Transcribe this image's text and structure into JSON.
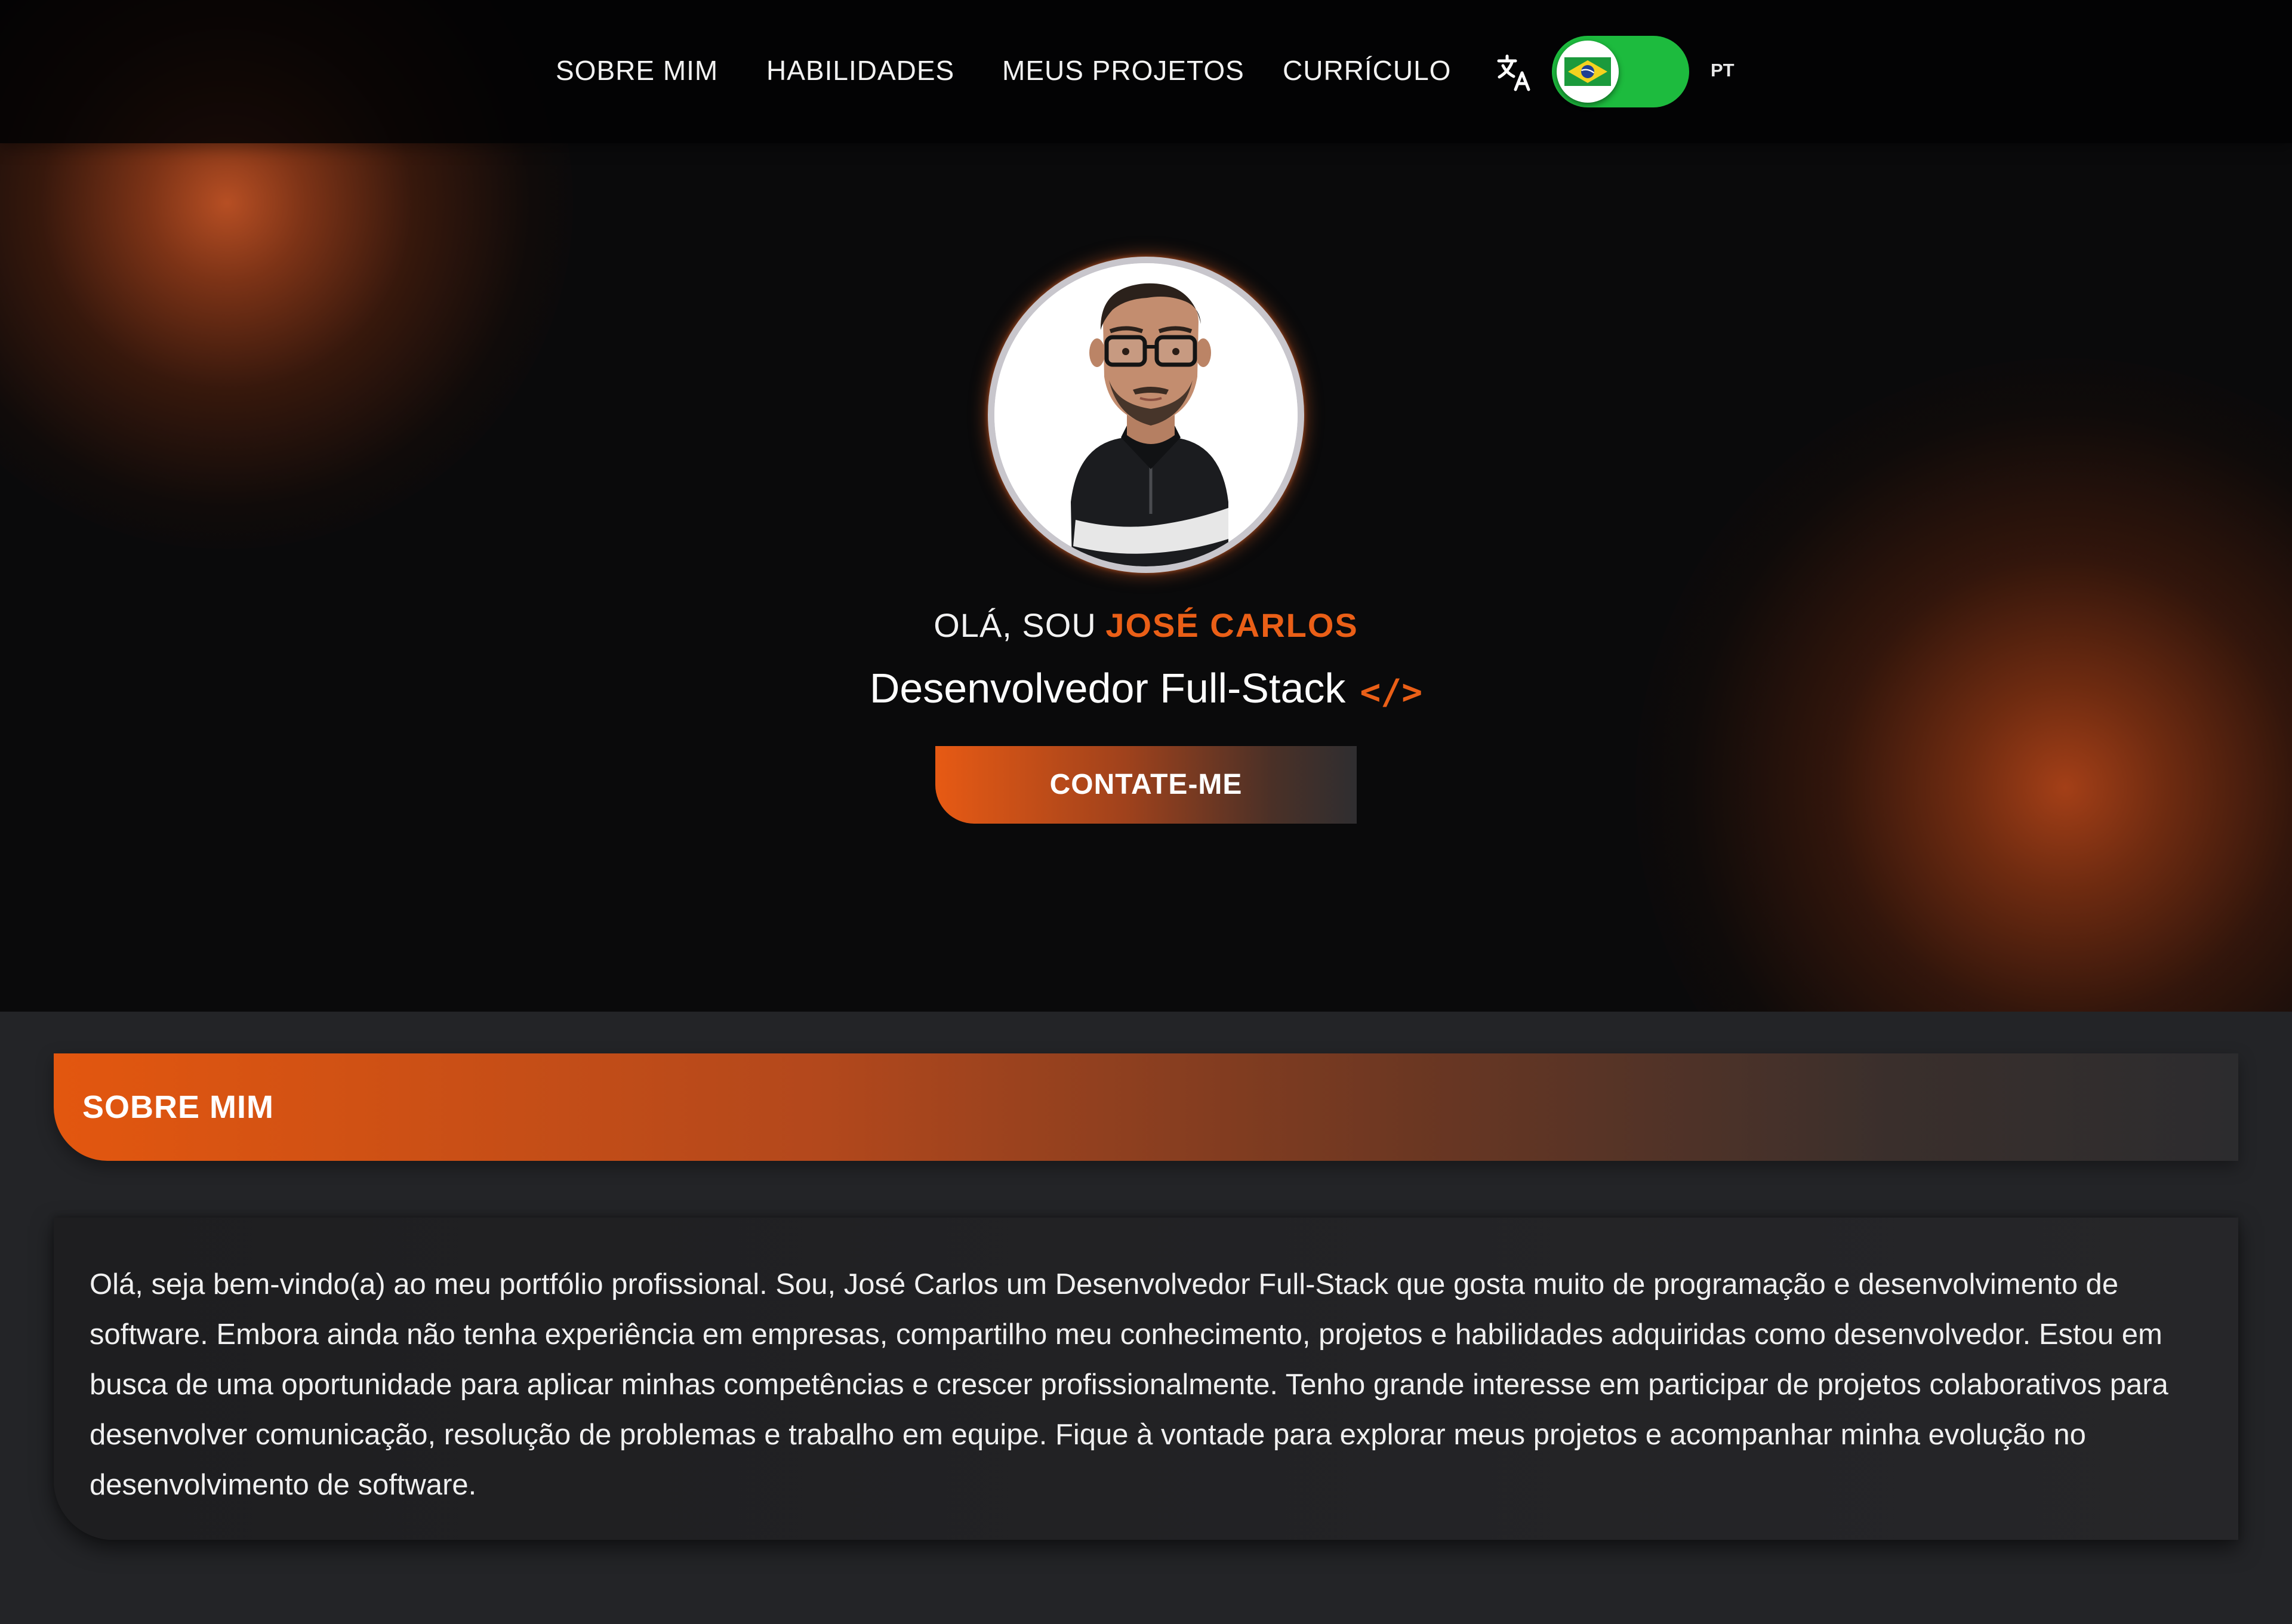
{
  "nav": {
    "links": [
      "SOBRE MIM",
      "HABILIDADES",
      "MEUS PROJETOS",
      "CURRÍCULO"
    ],
    "language_code": "PT",
    "translate_icon": "translate-icon",
    "flag_icon": "brazil-flag-icon"
  },
  "hero": {
    "greeting_prefix": "OLÁ, SOU",
    "name": "JOSÉ CARLOS",
    "role": "Desenvolvedor Full-Stack",
    "role_icon": "</>",
    "contact_button": "CONTATE-ME"
  },
  "about": {
    "title": "SOBRE MIM",
    "text": "Olá, seja bem-vindo(a) ao meu portfólio profissional. Sou, José Carlos um Desenvolvedor Full-Stack que gosta muito de programação e desenvolvimento de software. Embora ainda não tenha experiência em empresas, compartilho meu conhecimento, projetos e habilidades adquiridas como desenvolvedor. Estou em busca de uma oportunidade para aplicar minhas competências e crescer profissionalmente. Tenho grande interesse em participar de projetos colaborativos para desenvolver comunicação, resolução de problemas e trabalho em equipe. Fique à vontade para explorar meus projetos e acompanhar minha evolução no desenvolvimento de software."
  },
  "colors": {
    "accent": "#ea5f17",
    "toggle_green": "#1dbb3e",
    "hero_background": "#0a0a0b",
    "section_background": "#232427"
  }
}
